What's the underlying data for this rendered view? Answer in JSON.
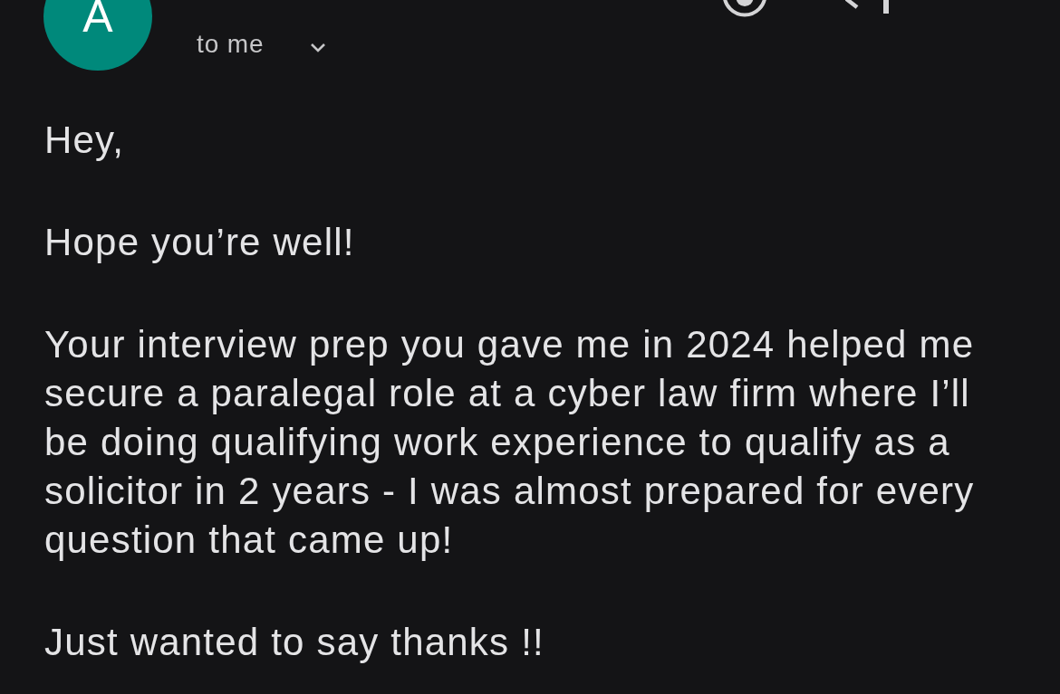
{
  "header": {
    "avatar_letter": "A",
    "recipient": "to me"
  },
  "body": {
    "paragraphs": [
      "Hey,",
      "Hope you’re well!",
      "Your interview prep you gave me in 2024 helped me secure a paralegal role at a cyber law firm where I’ll be doing qualifying work experience to qualify as a solicitor in 2 years - I was almost prepared for every question that came up!",
      "Just wanted to say thanks !!"
    ]
  }
}
